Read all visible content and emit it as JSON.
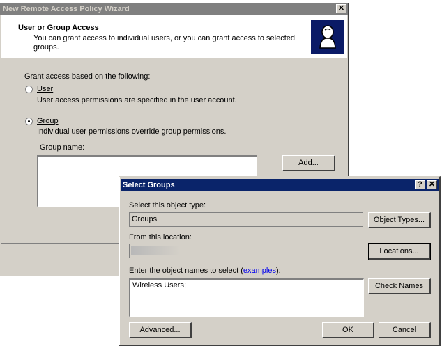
{
  "wizard": {
    "title": "New Remote Access Policy Wizard",
    "close_glyph": "✕",
    "header": {
      "title": "User or Group Access",
      "subtitle": "You can grant access to individual users, or you can grant access to selected groups."
    },
    "grant_label": "Grant access based on the following:",
    "options": {
      "user": {
        "label": "User",
        "description": "User access permissions are specified in the user account.",
        "selected": false
      },
      "group": {
        "label": "Group",
        "description": "Individual user permissions override group permissions.",
        "selected": true
      }
    },
    "group_name_label": "Group name:",
    "add_button": "Add..."
  },
  "dialog": {
    "title": "Select Groups",
    "help_glyph": "?",
    "close_glyph": "✕",
    "object_type_label": "Select this object type:",
    "object_type_value": "Groups",
    "object_types_button": "Object Types...",
    "location_label": "From this location:",
    "location_value": "",
    "locations_button": "Locations...",
    "names_label_prefix": "Enter the object names to select (",
    "names_label_link": "examples",
    "names_label_suffix": "):",
    "names_value": "Wireless Users;",
    "check_names_button": "Check Names",
    "advanced_button": "Advanced...",
    "ok_button": "OK",
    "cancel_button": "Cancel"
  },
  "colors": {
    "dialog_face": "#d4d0c8",
    "active_title": "#0a246a",
    "inactive_title": "#808080",
    "link": "#0000ee"
  }
}
